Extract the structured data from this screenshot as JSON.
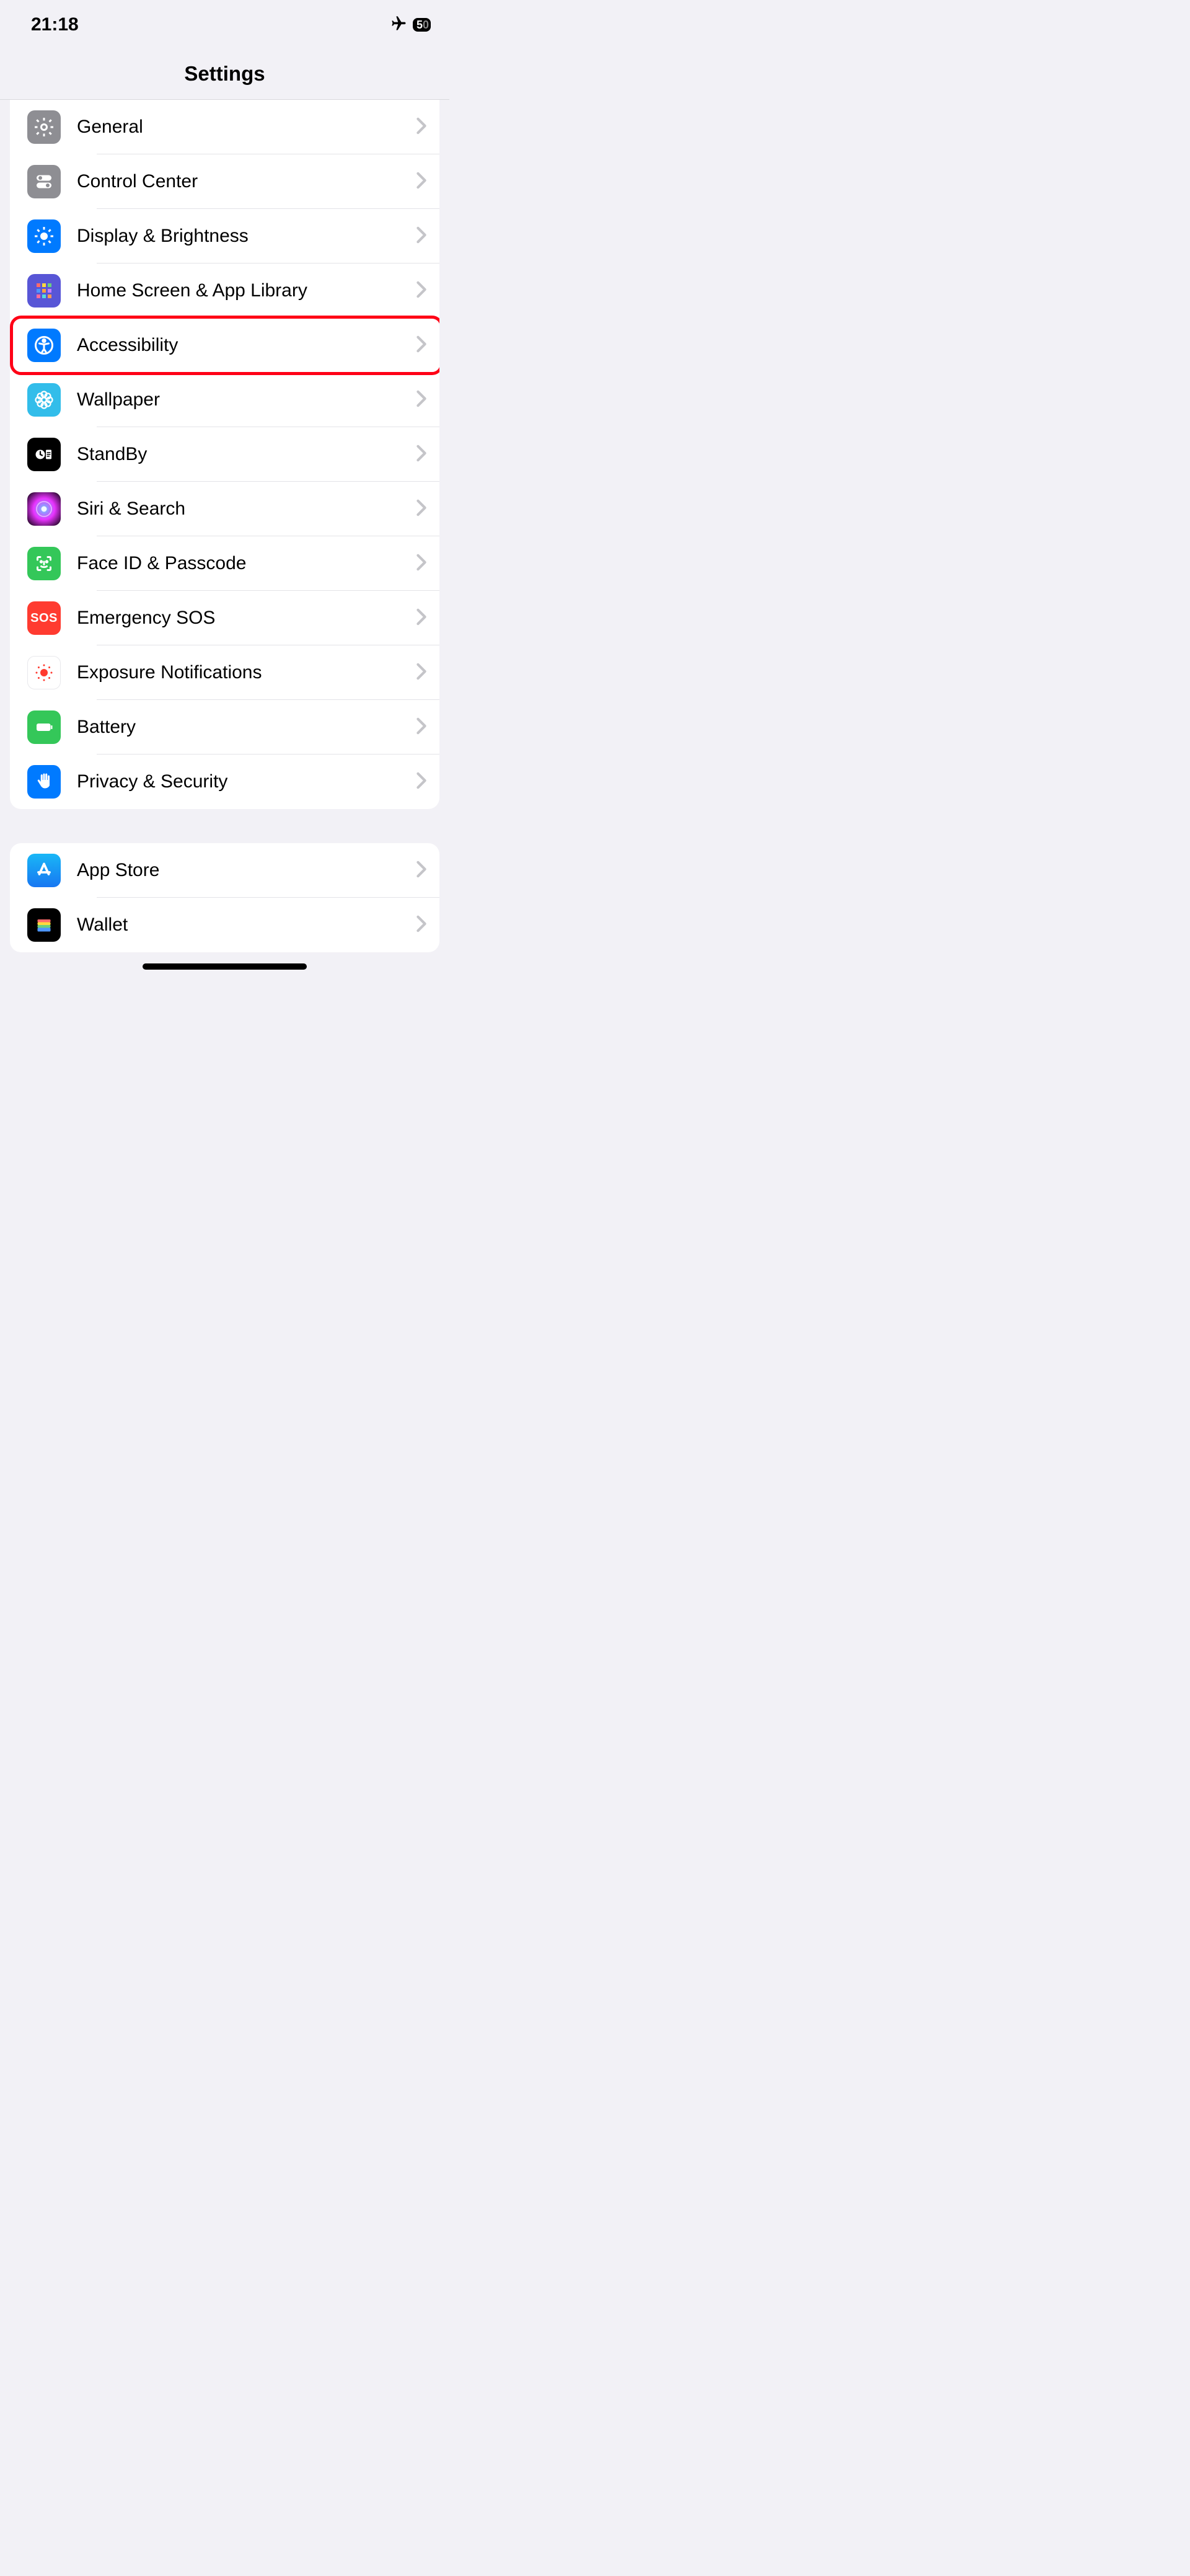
{
  "status": {
    "time": "21:18",
    "battery": "50"
  },
  "header": {
    "title": "Settings"
  },
  "groups": [
    {
      "rows": [
        {
          "id": "general",
          "label": "General",
          "icon": "gear",
          "bg": "bg-gray"
        },
        {
          "id": "control-center",
          "label": "Control Center",
          "icon": "switches",
          "bg": "bg-gray"
        },
        {
          "id": "display",
          "label": "Display & Brightness",
          "icon": "sun",
          "bg": "bg-blue"
        },
        {
          "id": "home-screen",
          "label": "Home Screen & App Library",
          "icon": "apps",
          "bg": "bg-indigo"
        },
        {
          "id": "accessibility",
          "label": "Accessibility",
          "icon": "accessibility",
          "bg": "bg-blue",
          "highlight": true
        },
        {
          "id": "wallpaper",
          "label": "Wallpaper",
          "icon": "flower",
          "bg": "bg-cyan"
        },
        {
          "id": "standby",
          "label": "StandBy",
          "icon": "standby",
          "bg": "bg-black"
        },
        {
          "id": "siri",
          "label": "Siri & Search",
          "icon": "siri",
          "bg": "bg-siri"
        },
        {
          "id": "faceid",
          "label": "Face ID & Passcode",
          "icon": "faceid",
          "bg": "bg-green"
        },
        {
          "id": "sos",
          "label": "Emergency SOS",
          "icon": "sos",
          "bg": "bg-red"
        },
        {
          "id": "exposure",
          "label": "Exposure Notifications",
          "icon": "exposure",
          "bg": "bg-white"
        },
        {
          "id": "battery",
          "label": "Battery",
          "icon": "battery",
          "bg": "bg-green"
        },
        {
          "id": "privacy",
          "label": "Privacy & Security",
          "icon": "hand",
          "bg": "bg-blue"
        }
      ]
    },
    {
      "rows": [
        {
          "id": "appstore",
          "label": "App Store",
          "icon": "appstore",
          "bg": "bg-appstore"
        },
        {
          "id": "wallet",
          "label": "Wallet",
          "icon": "wallet",
          "bg": "bg-wallet"
        }
      ]
    }
  ]
}
